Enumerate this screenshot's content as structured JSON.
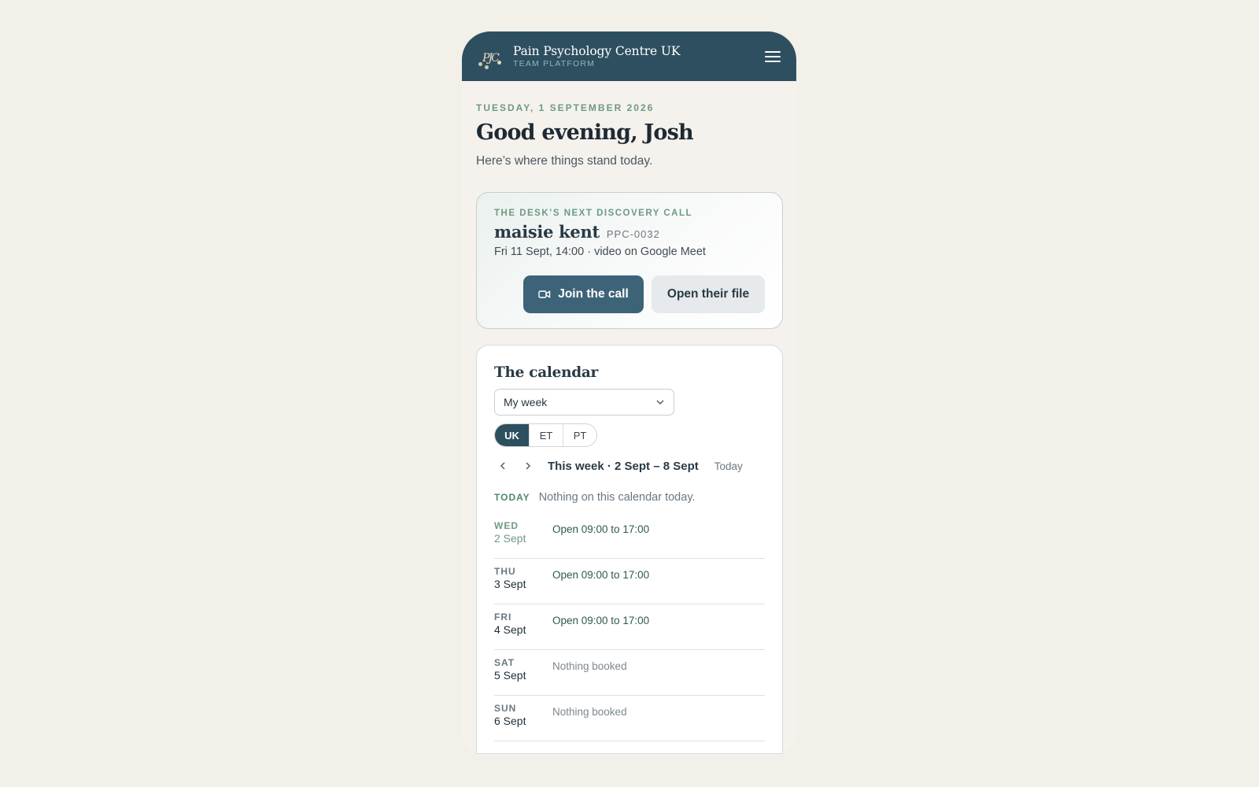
{
  "header": {
    "logo_text": "PJC",
    "brand_name": "Pain Psychology Centre UK",
    "brand_sub": "TEAM PLATFORM",
    "menu_icon": "hamburger-icon"
  },
  "intro": {
    "date": "TUESDAY, 1 SEPTEMBER 2026",
    "greeting": "Good evening, Josh",
    "subtitle": "Here’s where things stand today."
  },
  "next_call": {
    "eyebrow": "THE DESK’S NEXT DISCOVERY CALL",
    "client_name": "maisie kent",
    "client_id": "PPC-0032",
    "time": "Fri 11 Sept, 14:00 · video on Google Meet",
    "join_label": "Join the call",
    "file_label": "Open their file"
  },
  "calendar": {
    "title": "The calendar",
    "view_selected": "My week",
    "timezones": [
      {
        "label": "UK",
        "active": true
      },
      {
        "label": "ET",
        "active": false
      },
      {
        "label": "PT",
        "active": false
      }
    ],
    "week_label": "This week · 2 Sept – 8 Sept",
    "today_link": "Today",
    "today_tag": "TODAY",
    "today_msg": "Nothing on this calendar today.",
    "days": [
      {
        "dow": "WED",
        "date": "2 Sept",
        "status": "Open 09:00 to 17:00",
        "open": true
      },
      {
        "dow": "THU",
        "date": "3 Sept",
        "status": "Open 09:00 to 17:00",
        "open": true
      },
      {
        "dow": "FRI",
        "date": "4 Sept",
        "status": "Open 09:00 to 17:00",
        "open": true
      },
      {
        "dow": "SAT",
        "date": "5 Sept",
        "status": "Nothing booked",
        "open": false
      },
      {
        "dow": "SUN",
        "date": "6 Sept",
        "status": "Nothing booked",
        "open": false
      }
    ]
  },
  "colors": {
    "header_bg": "#2e4f60",
    "accent_green": "#6d9a83",
    "button_primary": "#3d6378",
    "page_bg": "#f3efe9"
  }
}
